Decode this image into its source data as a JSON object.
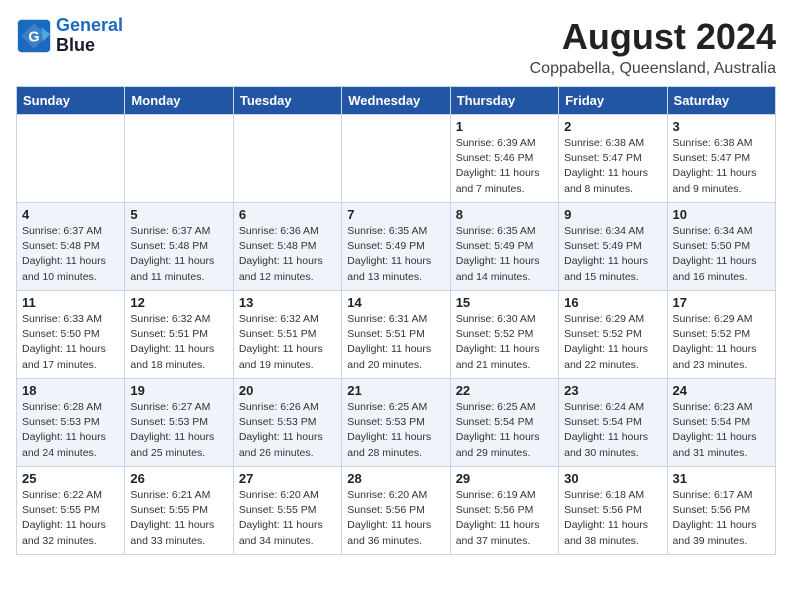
{
  "header": {
    "logo_line1": "General",
    "logo_line2": "Blue",
    "month_year": "August 2024",
    "location": "Coppabella, Queensland, Australia"
  },
  "weekdays": [
    "Sunday",
    "Monday",
    "Tuesday",
    "Wednesday",
    "Thursday",
    "Friday",
    "Saturday"
  ],
  "weeks": [
    [
      {
        "day": "",
        "info": ""
      },
      {
        "day": "",
        "info": ""
      },
      {
        "day": "",
        "info": ""
      },
      {
        "day": "",
        "info": ""
      },
      {
        "day": "1",
        "info": "Sunrise: 6:39 AM\nSunset: 5:46 PM\nDaylight: 11 hours\nand 7 minutes."
      },
      {
        "day": "2",
        "info": "Sunrise: 6:38 AM\nSunset: 5:47 PM\nDaylight: 11 hours\nand 8 minutes."
      },
      {
        "day": "3",
        "info": "Sunrise: 6:38 AM\nSunset: 5:47 PM\nDaylight: 11 hours\nand 9 minutes."
      }
    ],
    [
      {
        "day": "4",
        "info": "Sunrise: 6:37 AM\nSunset: 5:48 PM\nDaylight: 11 hours\nand 10 minutes."
      },
      {
        "day": "5",
        "info": "Sunrise: 6:37 AM\nSunset: 5:48 PM\nDaylight: 11 hours\nand 11 minutes."
      },
      {
        "day": "6",
        "info": "Sunrise: 6:36 AM\nSunset: 5:48 PM\nDaylight: 11 hours\nand 12 minutes."
      },
      {
        "day": "7",
        "info": "Sunrise: 6:35 AM\nSunset: 5:49 PM\nDaylight: 11 hours\nand 13 minutes."
      },
      {
        "day": "8",
        "info": "Sunrise: 6:35 AM\nSunset: 5:49 PM\nDaylight: 11 hours\nand 14 minutes."
      },
      {
        "day": "9",
        "info": "Sunrise: 6:34 AM\nSunset: 5:49 PM\nDaylight: 11 hours\nand 15 minutes."
      },
      {
        "day": "10",
        "info": "Sunrise: 6:34 AM\nSunset: 5:50 PM\nDaylight: 11 hours\nand 16 minutes."
      }
    ],
    [
      {
        "day": "11",
        "info": "Sunrise: 6:33 AM\nSunset: 5:50 PM\nDaylight: 11 hours\nand 17 minutes."
      },
      {
        "day": "12",
        "info": "Sunrise: 6:32 AM\nSunset: 5:51 PM\nDaylight: 11 hours\nand 18 minutes."
      },
      {
        "day": "13",
        "info": "Sunrise: 6:32 AM\nSunset: 5:51 PM\nDaylight: 11 hours\nand 19 minutes."
      },
      {
        "day": "14",
        "info": "Sunrise: 6:31 AM\nSunset: 5:51 PM\nDaylight: 11 hours\nand 20 minutes."
      },
      {
        "day": "15",
        "info": "Sunrise: 6:30 AM\nSunset: 5:52 PM\nDaylight: 11 hours\nand 21 minutes."
      },
      {
        "day": "16",
        "info": "Sunrise: 6:29 AM\nSunset: 5:52 PM\nDaylight: 11 hours\nand 22 minutes."
      },
      {
        "day": "17",
        "info": "Sunrise: 6:29 AM\nSunset: 5:52 PM\nDaylight: 11 hours\nand 23 minutes."
      }
    ],
    [
      {
        "day": "18",
        "info": "Sunrise: 6:28 AM\nSunset: 5:53 PM\nDaylight: 11 hours\nand 24 minutes."
      },
      {
        "day": "19",
        "info": "Sunrise: 6:27 AM\nSunset: 5:53 PM\nDaylight: 11 hours\nand 25 minutes."
      },
      {
        "day": "20",
        "info": "Sunrise: 6:26 AM\nSunset: 5:53 PM\nDaylight: 11 hours\nand 26 minutes."
      },
      {
        "day": "21",
        "info": "Sunrise: 6:25 AM\nSunset: 5:53 PM\nDaylight: 11 hours\nand 28 minutes."
      },
      {
        "day": "22",
        "info": "Sunrise: 6:25 AM\nSunset: 5:54 PM\nDaylight: 11 hours\nand 29 minutes."
      },
      {
        "day": "23",
        "info": "Sunrise: 6:24 AM\nSunset: 5:54 PM\nDaylight: 11 hours\nand 30 minutes."
      },
      {
        "day": "24",
        "info": "Sunrise: 6:23 AM\nSunset: 5:54 PM\nDaylight: 11 hours\nand 31 minutes."
      }
    ],
    [
      {
        "day": "25",
        "info": "Sunrise: 6:22 AM\nSunset: 5:55 PM\nDaylight: 11 hours\nand 32 minutes."
      },
      {
        "day": "26",
        "info": "Sunrise: 6:21 AM\nSunset: 5:55 PM\nDaylight: 11 hours\nand 33 minutes."
      },
      {
        "day": "27",
        "info": "Sunrise: 6:20 AM\nSunset: 5:55 PM\nDaylight: 11 hours\nand 34 minutes."
      },
      {
        "day": "28",
        "info": "Sunrise: 6:20 AM\nSunset: 5:56 PM\nDaylight: 11 hours\nand 36 minutes."
      },
      {
        "day": "29",
        "info": "Sunrise: 6:19 AM\nSunset: 5:56 PM\nDaylight: 11 hours\nand 37 minutes."
      },
      {
        "day": "30",
        "info": "Sunrise: 6:18 AM\nSunset: 5:56 PM\nDaylight: 11 hours\nand 38 minutes."
      },
      {
        "day": "31",
        "info": "Sunrise: 6:17 AM\nSunset: 5:56 PM\nDaylight: 11 hours\nand 39 minutes."
      }
    ]
  ]
}
